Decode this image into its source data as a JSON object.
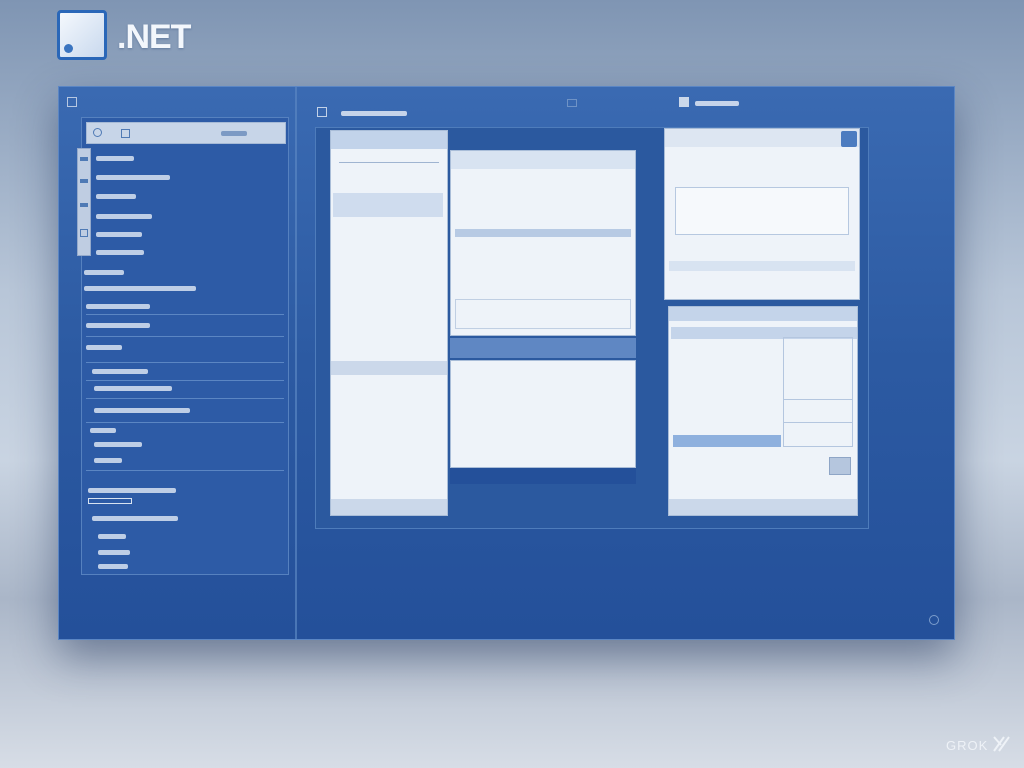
{
  "logo": {
    "text": ".NET",
    "icon": "dotnet-logo-icon"
  },
  "watermark": {
    "text": "GROK",
    "icon": "grok-logo-icon"
  },
  "colors": {
    "window": "#2c5aa2",
    "pane": "#eef3f9",
    "accent": "#2a67b8"
  }
}
